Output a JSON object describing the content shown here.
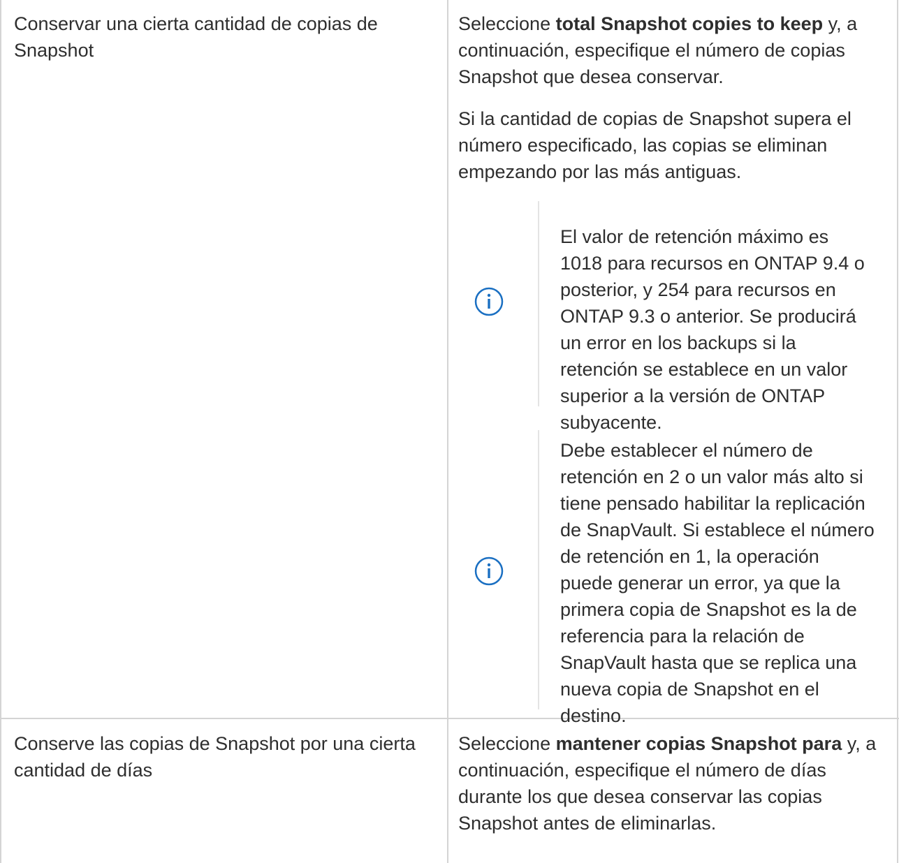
{
  "rows": [
    {
      "option": "Conservar una cierta cantidad de copias de Snapshot",
      "desc_pre": "Seleccione ",
      "desc_bold": "total Snapshot copies to keep",
      "desc_post": " y, a continuación, especifique el número de copias Snapshot que desea conservar.",
      "para2": "Si la cantidad de copias de Snapshot supera el número especificado, las copias se eliminan empezando por las más antiguas.",
      "notes": [
        {
          "icon": "info-circle-icon",
          "text": "El valor de retención máximo es 1018 para recursos en ONTAP 9.4 o posterior, y 254 para recursos en ONTAP 9.3 o anterior. Se producirá un error en los backups si la retención se establece en un valor superior a la versión de ONTAP subyacente."
        },
        {
          "icon": "info-circle-icon",
          "text": "Debe establecer el número de retención en 2 o un valor más alto si tiene pensado habilitar la replicación de SnapVault. Si establece el número de retención en 1, la operación puede generar un error, ya que la primera copia de Snapshot es la de referencia para la relación de SnapVault hasta que se replica una nueva copia de Snapshot en el destino."
        }
      ]
    },
    {
      "option": "Conserve las copias de Snapshot por una cierta cantidad de días",
      "desc_pre": "Seleccione ",
      "desc_bold": "mantener copias Snapshot para",
      "desc_post": " y, a continuación, especifique el número de días durante los que desea conservar las copias Snapshot antes de eliminarlas."
    }
  ],
  "colors": {
    "text": "#2e2e2e",
    "border": "#d4d4d4",
    "icon": "#1a6fc2"
  }
}
